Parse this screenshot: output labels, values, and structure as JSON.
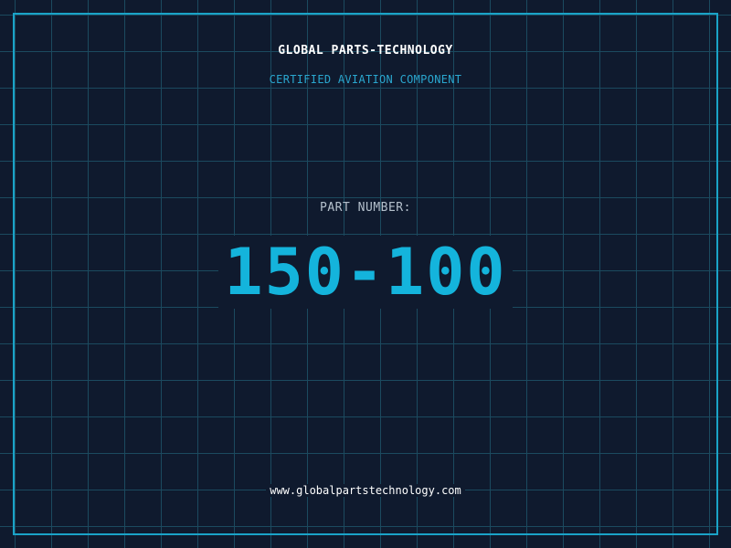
{
  "header": {
    "company": "GLOBAL PARTS-TECHNOLOGY",
    "subtitle": "CERTIFIED AVIATION COMPONENT"
  },
  "part": {
    "label": "PART NUMBER:",
    "number": "150-100"
  },
  "footer": {
    "website": "www.globalpartstechnology.com"
  },
  "colors": {
    "background": "#0f1a2e",
    "grid": "#1b4a5f",
    "accent": "#14b4dc",
    "frame": "#1aa3c8"
  }
}
